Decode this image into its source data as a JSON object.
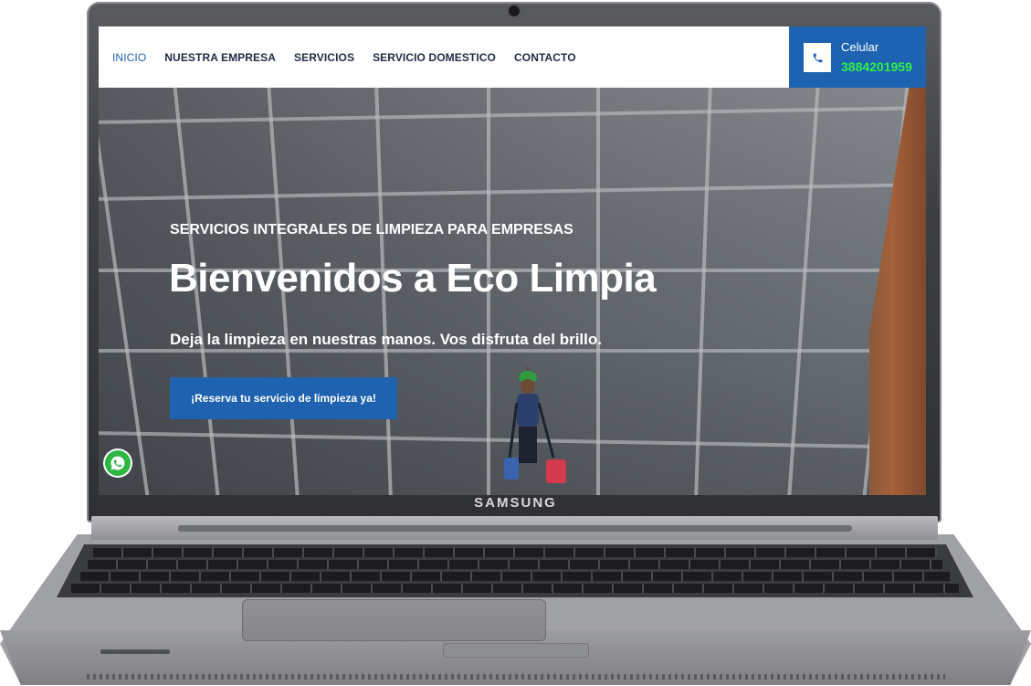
{
  "device": {
    "brand": "SAMSUNG"
  },
  "nav": {
    "items": [
      "INICIO",
      "NUESTRA EMPRESA",
      "SERVICIOS",
      "SERVICIO DOMESTICO",
      "CONTACTO"
    ],
    "active": "INICIO"
  },
  "contact": {
    "label": "Celular",
    "phone": "3884201959"
  },
  "hero": {
    "subtitle": "SERVICIOS INTEGRALES DE LIMPIEZA PARA EMPRESAS",
    "title": "Bienvenidos a Eco Limpia",
    "description": "Deja la limpieza en nuestras manos. Vos disfruta del brillo.",
    "cta_label": "¡Reserva tu servicio de limpieza ya!"
  },
  "icons": {
    "phone": "phone-icon",
    "whatsapp": "whatsapp-icon",
    "camera": "webcam-icon"
  },
  "colors": {
    "primary": "#1e63b1",
    "phone_number": "#2ef04a",
    "nav_text": "#1f2a44",
    "whatsapp": "#2bb741"
  }
}
